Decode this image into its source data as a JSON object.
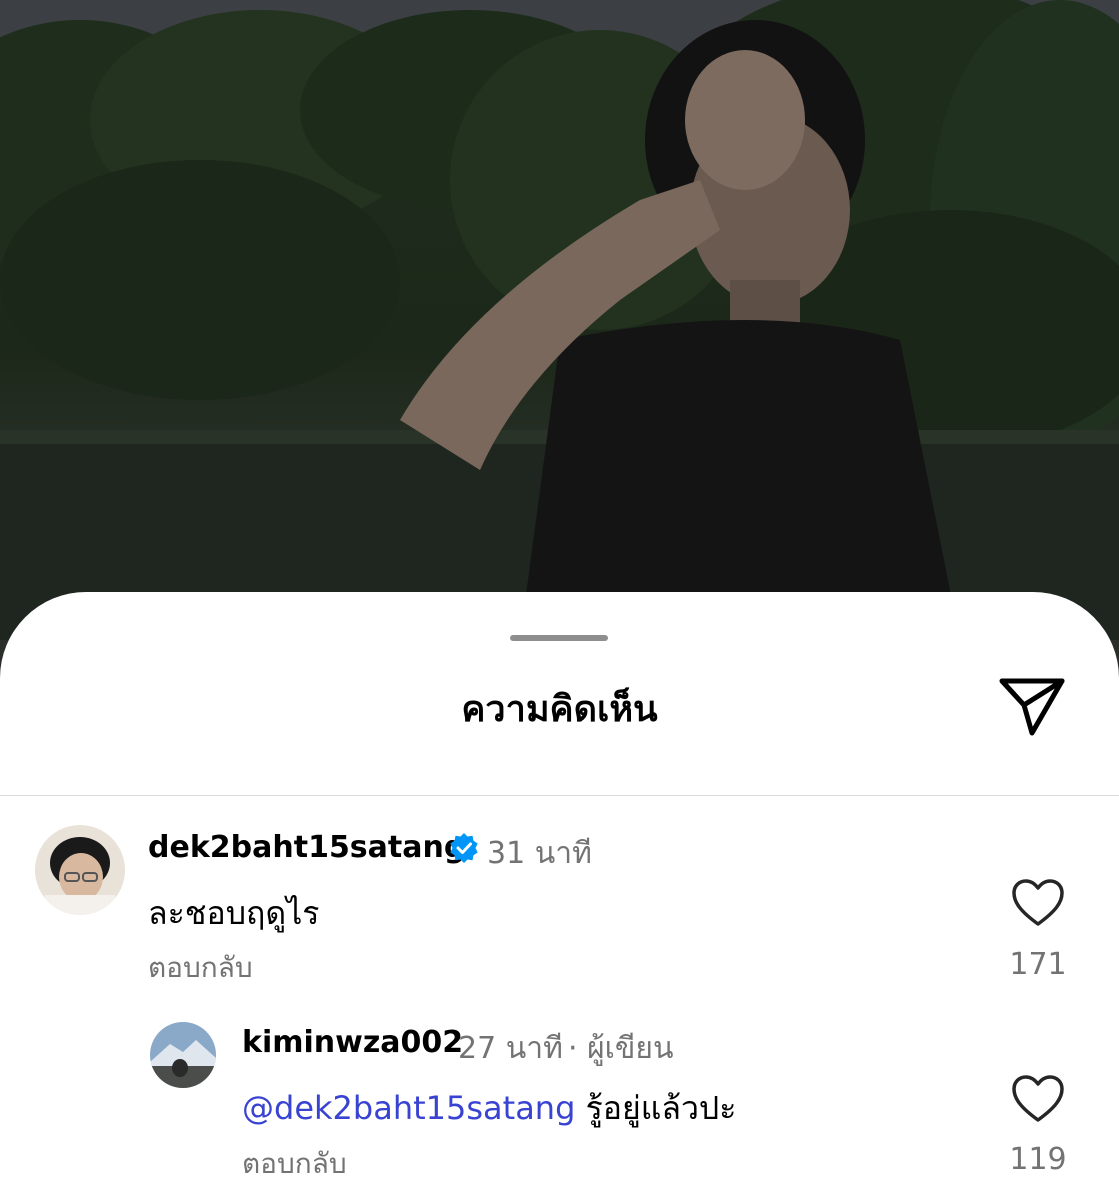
{
  "sheet": {
    "title": "ความคิดเห็น"
  },
  "comments": [
    {
      "username": "dek2baht15satang",
      "verified": true,
      "time": "31 นาที",
      "text": "ละชอบฤดูไร",
      "reply_label": "ตอบกลับ",
      "likes": "171"
    },
    {
      "username": "kiminwza002",
      "time": "27 นาที",
      "author_label": "· ผู้เขียน",
      "mention": "@dek2baht15satang",
      "text": "รู้อยู่แล้วปะ",
      "reply_label": "ตอบกลับ",
      "likes": "119"
    }
  ],
  "colors": {
    "mention": "#3943d1",
    "verified": "#0095f6",
    "muted": "#737373"
  },
  "icons": [
    "share-send-icon",
    "verified-badge-icon",
    "heart-icon"
  ]
}
